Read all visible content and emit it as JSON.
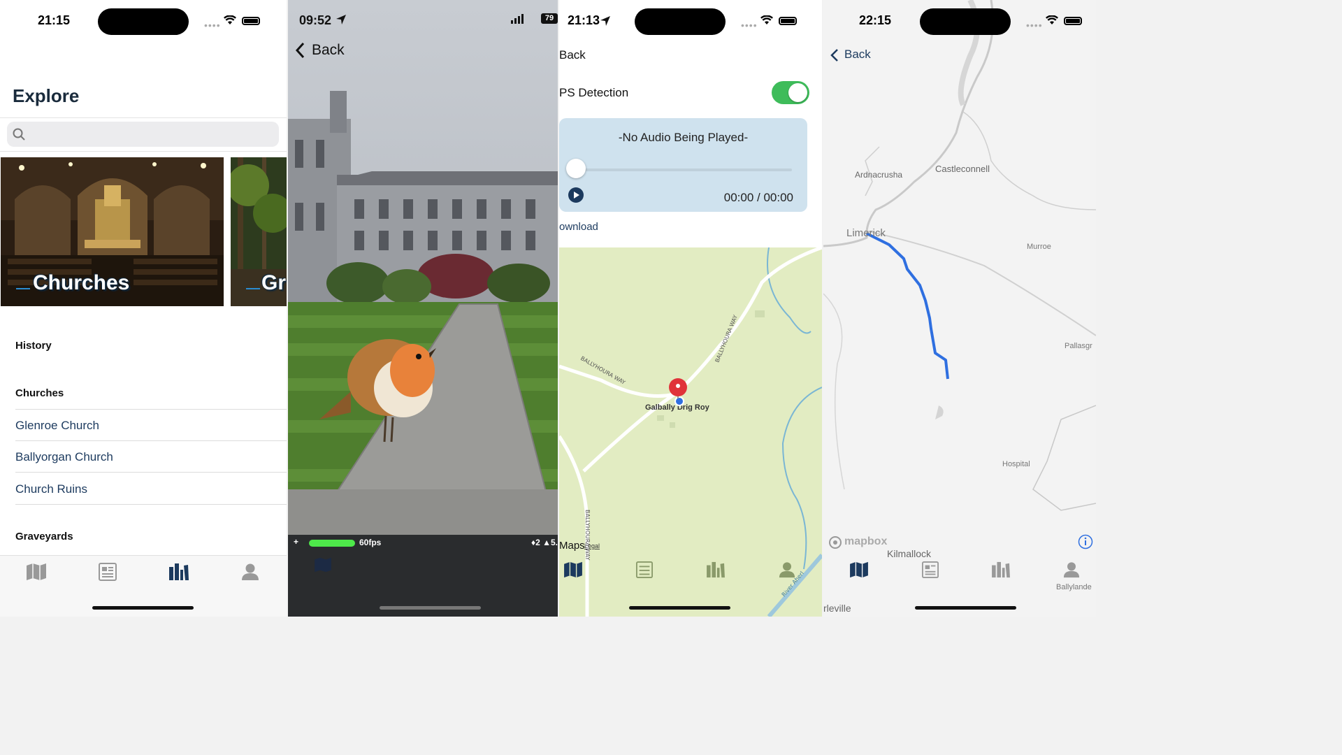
{
  "screens": [
    {
      "status_time": "21:15",
      "title": "Explore",
      "search_placeholder": "",
      "cards": [
        {
          "label": "Churches"
        },
        {
          "label": "Gr"
        }
      ],
      "sections": [
        {
          "heading": "History",
          "items": []
        },
        {
          "heading": "Churches",
          "items": [
            "Glenroe Church",
            "Ballyorgan Church",
            "Church Ruins"
          ]
        },
        {
          "heading": "Graveyards",
          "items": []
        }
      ],
      "tabs": [
        "map-icon",
        "news-icon",
        "library-icon",
        "profile-icon"
      ],
      "active_tab": "library-icon"
    },
    {
      "status_time": "09:52",
      "battery": "79",
      "back_label": "Back",
      "fps_label": "60fps",
      "debug_right": "♦2 ▲5."
    },
    {
      "status_time": "21:13",
      "back_label": "Back",
      "gps_label": "PS Detection",
      "gps_enabled": true,
      "audio_status": "-No Audio Being Played-",
      "time_display": "00:00 / 00:00",
      "download_label": "ownload",
      "map_labels": {
        "place": "Galbally Drig Roy",
        "road1": "BALLYHOURA WAY",
        "road2": "BALLYHOURA WAY",
        "road3": "BALLYHOURA WAY",
        "river": "River Aherl",
        "maps": "Maps",
        "legal": "Legal"
      }
    },
    {
      "status_time": "22:15",
      "back_label": "Back",
      "map_labels": {
        "ardnacrusha": "Ardnacrusha",
        "castleconnell": "Castleconnell",
        "limerick": "Limerick",
        "murroe": "Murroe",
        "pallas": "Pallasgr",
        "hospital": "Hospital",
        "kilmallock": "Kilmallock",
        "charleville": "rleville",
        "ballylanders": "Ballylande"
      },
      "attribution": "mapbox",
      "route_color": "#2f6fe0"
    }
  ]
}
